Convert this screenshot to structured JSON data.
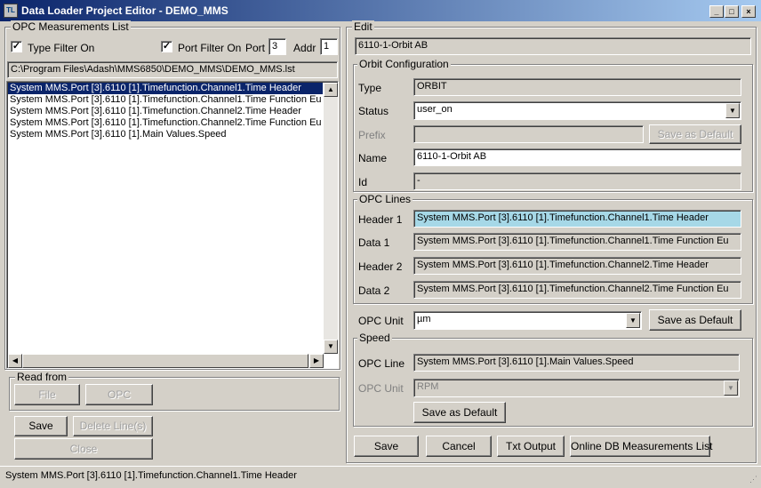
{
  "window": {
    "icon_text": "TL",
    "title": "Data Loader Project Editor - DEMO_MMS",
    "min_glyph": "_",
    "max_glyph": "□",
    "close_glyph": "×"
  },
  "left": {
    "group_title": "OPC Measurements List",
    "type_filter": {
      "label": "Type Filter On",
      "checked": "✓"
    },
    "port_filter": {
      "label": "Port Filter On",
      "checked": "✓"
    },
    "port_label": "Port",
    "port_value": "3",
    "addr_label": "Addr",
    "addr_value": "1",
    "path": "C:\\Program Files\\Adash\\MMS6850\\DEMO_MMS\\DEMO_MMS.lst",
    "items": [
      "System MMS.Port [3].6110 [1].Timefunction.Channel1.Time Header",
      "System MMS.Port [3].6110 [1].Timefunction.Channel1.Time Function Eu",
      "System MMS.Port [3].6110 [1].Timefunction.Channel2.Time Header",
      "System MMS.Port [3].6110 [1].Timefunction.Channel2.Time Function Eu",
      "System MMS.Port [3].6110 [1].Main Values.Speed"
    ],
    "scroll_up": "▲",
    "scroll_down": "▼",
    "scroll_left": "◀",
    "scroll_right": "▶",
    "read_from": {
      "title": "Read from",
      "file": "File",
      "opc": "OPC"
    },
    "save": "Save",
    "delete_lines": "Delete Line(s)",
    "close": "Close"
  },
  "edit": {
    "group_title": "Edit",
    "name_value": "6110-1-Orbit AB",
    "orbit_config": {
      "title": "Orbit Configuration",
      "type_label": "Type",
      "type_value": "ORBIT",
      "status_label": "Status",
      "status_value": "user_on",
      "prefix_label": "Prefix",
      "prefix_value": "",
      "save_default": "Save as Default",
      "name_label": "Name",
      "name_value": "6110-1-Orbit AB",
      "id_label": "Id",
      "id_value": "-"
    },
    "opc_lines": {
      "title": "OPC Lines",
      "rows": [
        {
          "label": "Header 1",
          "value": "System MMS.Port [3].6110 [1].Timefunction.Channel1.Time Header"
        },
        {
          "label": "Data 1",
          "value": "System MMS.Port [3].6110 [1].Timefunction.Channel1.Time Function Eu"
        },
        {
          "label": "Header 2",
          "value": "System MMS.Port [3].6110 [1].Timefunction.Channel2.Time Header"
        },
        {
          "label": "Data 2",
          "value": "System MMS.Port [3].6110 [1].Timefunction.Channel2.Time Function Eu"
        }
      ],
      "highlight_color": "#a6d8e7"
    },
    "opc_unit": {
      "label": "OPC Unit",
      "value": "µm",
      "save_default": "Save as Default"
    },
    "speed": {
      "title": "Speed",
      "opc_line_label": "OPC Line",
      "opc_line_value": "System MMS.Port [3].6110 [1].Main Values.Speed",
      "opc_unit_label": "OPC Unit",
      "opc_unit_value": "RPM",
      "save_default": "Save as Default"
    },
    "dropdown_glyph": "▼"
  },
  "bottom_buttons": {
    "save": "Save",
    "cancel": "Cancel",
    "txt_output": "Txt Output",
    "online_db": "Online DB Measurements List"
  },
  "status_bar": {
    "text": "System MMS.Port [3].6110 [1].Timefunction.Channel1.Time Header"
  }
}
